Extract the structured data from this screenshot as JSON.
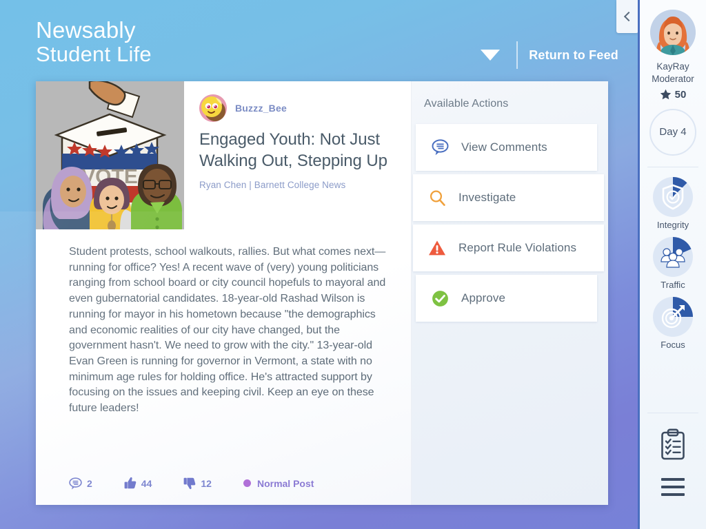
{
  "header": {
    "brand_top": "Newsably",
    "brand_sub": "Student Life",
    "return_label": "Return to Feed",
    "caret_icon": "caret-down-icon",
    "collapse_icon": "chevron-left-icon"
  },
  "article": {
    "poster": "Buzzz_Bee",
    "poster_avatar_icon": "bee-avatar",
    "thumbnail_icon": "ballot-box-illustration",
    "headline": "Engaged Youth: Not Just Walking Out, Stepping Up",
    "byline": "Ryan Chen | Barnett College News",
    "body": "Student protests, school walkouts, rallies. But what comes next—running for office? Yes! A recent wave of (very) young politicians ranging from school board or city council hopefuls to mayoral and even gubernatorial candidates. 18-year-old Rashad Wilson is running for mayor in his hometown because \"the demographics and economic realities of our city have changed, but the government hasn't. We need to grow with the city.\" 13-year-old Evan Green is running for governor in Vermont, a state with no minimum age rules for holding office. He's attracted support by focusing on the issues and keeping civil. Keep an eye on these future leaders!",
    "stats": {
      "comments": "2",
      "likes": "44",
      "dislikes": "12",
      "badge_label": "Normal Post",
      "badge_color": "#b06fd8"
    }
  },
  "actions": {
    "title": "Available Actions",
    "items": [
      {
        "label": "View Comments",
        "icon": "comment-bubble-icon",
        "color": "#4a6fc0",
        "width": "narrow"
      },
      {
        "label": "Investigate",
        "icon": "magnifier-icon",
        "color": "#f0a13c",
        "width": "wide"
      },
      {
        "label": "Report Rule Violations",
        "icon": "warning-triangle-icon",
        "color": "#ee5b3e",
        "width": "wide"
      },
      {
        "label": "Approve",
        "icon": "check-circle-icon",
        "color": "#7ec242",
        "width": "narrow"
      }
    ]
  },
  "sidebar": {
    "user_name": "KayRay",
    "user_role": "Moderator",
    "score": "50",
    "score_icon": "star-icon",
    "day_label": "Day 4",
    "stats": [
      {
        "label": "Integrity",
        "icon": "shield-check-icon",
        "progress": 14
      },
      {
        "label": "Traffic",
        "icon": "people-group-icon",
        "progress": 22
      },
      {
        "label": "Focus",
        "icon": "target-arrow-icon",
        "progress": 25
      }
    ],
    "bottom_icons": [
      {
        "name": "clipboard-checklist-icon"
      },
      {
        "name": "hamburger-menu-icon"
      }
    ]
  },
  "theme": {
    "accent_blue": "#4a6fc0",
    "bg_top": "#74c0e8",
    "bg_bottom": "#7682d8"
  }
}
